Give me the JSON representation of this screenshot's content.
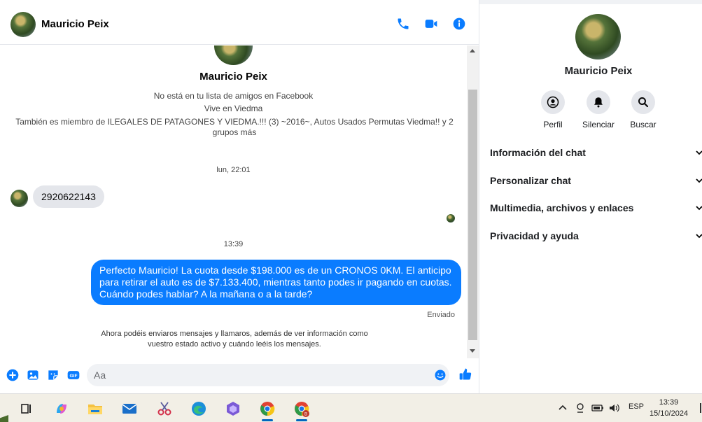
{
  "chat_header": {
    "name": "Mauricio Peix",
    "actions": [
      "phone-icon",
      "video-icon",
      "info-icon"
    ]
  },
  "profile": {
    "name": "Mauricio Peix",
    "friend_status": "No está en tu lista de amigos en Facebook",
    "location": "Vive en Viedma",
    "groups": "También es miembro de ILEGALES DE PATAGONES Y VIEDMA.!!! (3) ~2016~, Autos Usados Permutas Viedma!! y 2 grupos más"
  },
  "messages": {
    "time_1": "lun, 22:01",
    "incoming_1": "2920622143",
    "time_2": "13:39",
    "outgoing_1": "Perfecto Mauricio! La cuota desde $198.000 es de un CRONOS 0KM. El anticipo para retirar el auto es de $7.133.400, mientras tanto podes ir pagando en cuotas. Cuándo podes hablar? A la mañana o a la tarde?",
    "status": "Enviado",
    "notice": "Ahora podéis enviaros mensajes y llamaros, además de ver información como vuestro estado activo y cuándo leéis los mensajes."
  },
  "composer": {
    "placeholder": "Aa"
  },
  "info_pane": {
    "name": "Mauricio Peix",
    "actions": [
      {
        "label": "Perfil",
        "icon": "profile-icon"
      },
      {
        "label": "Silenciar",
        "icon": "bell-icon"
      },
      {
        "label": "Buscar",
        "icon": "search-icon"
      }
    ],
    "sections": [
      {
        "label": "Información del chat"
      },
      {
        "label": "Personalizar chat"
      },
      {
        "label": "Multimedia, archivos y enlaces"
      },
      {
        "label": "Privacidad y ayuda"
      }
    ]
  },
  "taskbar": {
    "apps": [
      "task-view-icon",
      "copilot-icon",
      "file-explorer-icon",
      "mail-icon",
      "snipping-tool-icon",
      "edge-icon",
      "app-icon",
      "chrome-icon",
      "chrome-profile-icon"
    ],
    "language": "ESP",
    "time": "13:39",
    "date": "15/10/2024"
  },
  "colors": {
    "accent": "#0a7cff",
    "messenger_blue": "#0084ff"
  }
}
